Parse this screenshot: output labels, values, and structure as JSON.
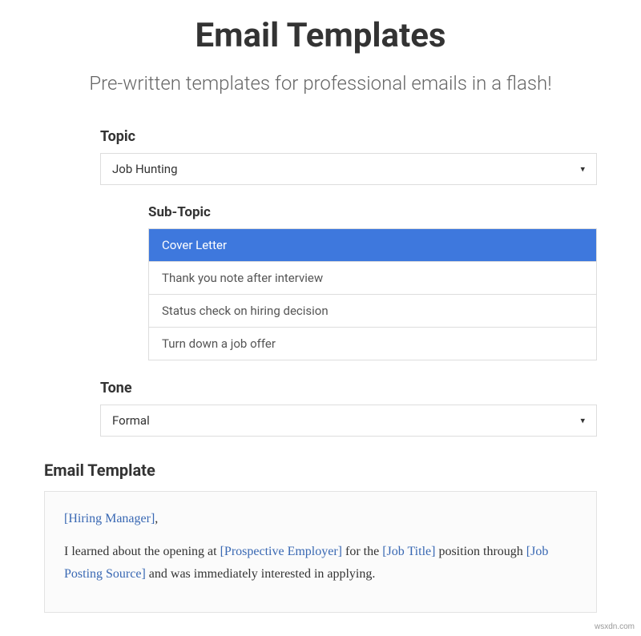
{
  "header": {
    "title": "Email Templates",
    "subheading": "Pre-written templates for professional emails in a flash!"
  },
  "topic": {
    "label": "Topic",
    "selected": "Job Hunting"
  },
  "subtopic": {
    "label": "Sub-Topic",
    "items": [
      {
        "label": "Cover Letter",
        "active": true
      },
      {
        "label": "Thank you note after interview",
        "active": false
      },
      {
        "label": "Status check on hiring decision",
        "active": false
      },
      {
        "label": "Turn down a job offer",
        "active": false
      }
    ]
  },
  "tone": {
    "label": "Tone",
    "selected": "Formal"
  },
  "template": {
    "heading": "Email Template",
    "greeting_placeholder": "[Hiring Manager]",
    "greeting_suffix": ",",
    "body_part1": "I learned about the opening at ",
    "body_ph1": "[Prospective Employer]",
    "body_part2": " for the ",
    "body_ph2": "[Job Title]",
    "body_part3": " position through ",
    "body_ph3": "[Job Posting Source]",
    "body_part4": " and was immediately interested in applying."
  },
  "watermark": "wsxdn.com"
}
